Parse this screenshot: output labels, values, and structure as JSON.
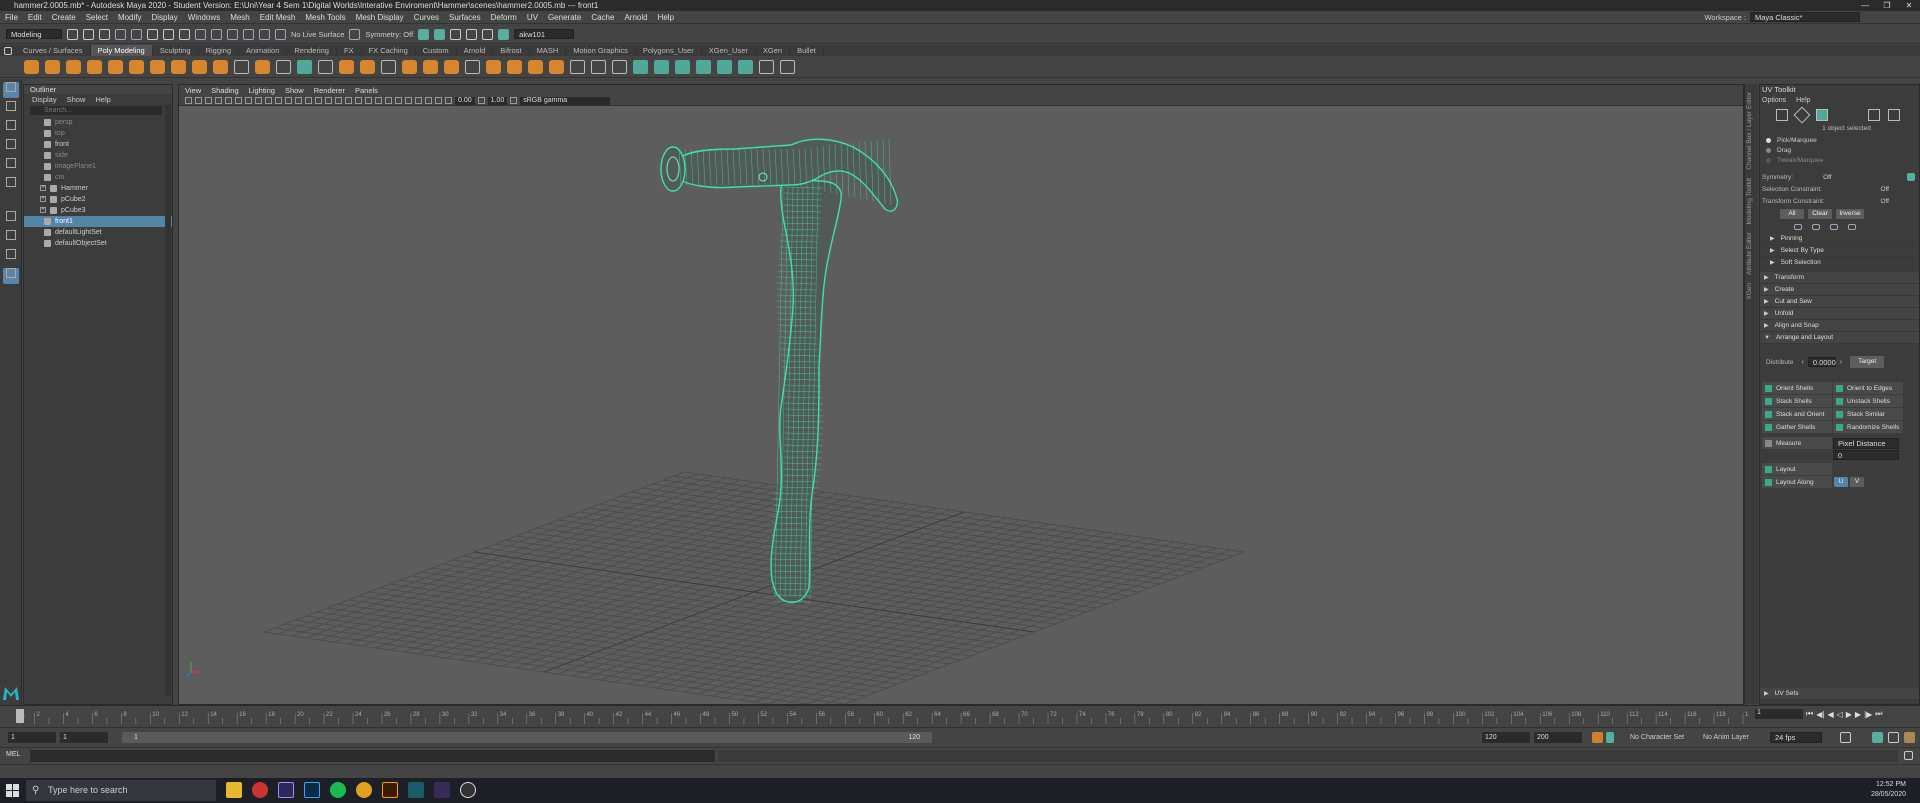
{
  "window": {
    "title": "hammer2.0005.mb* - Autodesk Maya 2020 - Student Version: E:\\Uni\\Year 4 Sem 1\\Digital Worlds\\Interative Enviroment\\Hammer\\scenes\\hammer2.0005.mb  ---  front1"
  },
  "menubar": {
    "items": [
      "File",
      "Edit",
      "Create",
      "Select",
      "Modify",
      "Display",
      "Windows",
      "Mesh",
      "Edit Mesh",
      "Mesh Tools",
      "Mesh Display",
      "Curves",
      "Surfaces",
      "Deform",
      "UV",
      "Generate",
      "Cache",
      "Arnold",
      "Help"
    ],
    "workspace_label": "Workspace :",
    "workspace_value": "Maya Classic*"
  },
  "statusline": {
    "menuset": "Modeling",
    "live_surface": "No Live Surface",
    "symmetry": "Symmetry: Off",
    "user": "akw101"
  },
  "shelf": {
    "tabs": [
      "Curves / Surfaces",
      "Poly Modeling",
      "Sculpting",
      "Rigging",
      "Animation",
      "Rendering",
      "FX",
      "FX Caching",
      "Custom",
      "Arnold",
      "Bifrost",
      "MASH",
      "Motion Graphics",
      "Polygons_User",
      "XGen_User",
      "XGen",
      "Bullet"
    ],
    "active_tab": "Poly Modeling"
  },
  "outliner": {
    "title": "Outliner",
    "menu": [
      "Display",
      "Show",
      "Help"
    ],
    "search_placeholder": "Search...",
    "items": [
      {
        "label": "persp",
        "dim": true,
        "expand": false
      },
      {
        "label": "top",
        "dim": true,
        "expand": false
      },
      {
        "label": "front",
        "dim": false,
        "expand": false
      },
      {
        "label": "side",
        "dim": true,
        "expand": false
      },
      {
        "label": "imagePlane1",
        "dim": true,
        "expand": false
      },
      {
        "label": "cm",
        "dim": true,
        "expand": false
      },
      {
        "label": "Hammer",
        "dim": false,
        "expand": true
      },
      {
        "label": "pCube2",
        "dim": false,
        "expand": true
      },
      {
        "label": "pCube3",
        "dim": false,
        "expand": true
      },
      {
        "label": "front1",
        "dim": false,
        "expand": false,
        "selected": true
      },
      {
        "label": "defaultLightSet",
        "dim": false,
        "expand": false
      },
      {
        "label": "defaultObjectSet",
        "dim": false,
        "expand": false
      }
    ]
  },
  "viewport": {
    "menu": [
      "View",
      "Shading",
      "Lighting",
      "Show",
      "Renderer",
      "Panels"
    ],
    "field_a": "0.00",
    "field_b": "1.00",
    "colorspace": "sRGB gamma"
  },
  "sidetabs": [
    "Channel Box / Layer Editor",
    "Modeling Toolkit",
    "Attribute Editor",
    "XGen"
  ],
  "uvtoolkit": {
    "title": "UV Toolkit",
    "menu": [
      "Options",
      "Help"
    ],
    "selected_text": "1 object selected",
    "modes": [
      {
        "label": "Pick/Marquee",
        "dim": false
      },
      {
        "label": "Drag",
        "dim": false
      },
      {
        "label": "Tweak/Marquee",
        "dim": true
      }
    ],
    "symmetry_label": "Symmetry:",
    "symmetry_value": "Off",
    "selection_constraint_label": "Selection Constraint:",
    "selection_constraint_value": "Off",
    "transform_constraint_label": "Transform Constraint:",
    "transform_constraint_value": "Off",
    "buttons": [
      "All",
      "Clear",
      "Inverse"
    ],
    "subsections": [
      "Pinning",
      "Select By Type",
      "Soft Selection"
    ],
    "sections": [
      "Transform",
      "Create",
      "Cut and Sew",
      "Unfold",
      "Align and Snap",
      "Arrange and Layout"
    ],
    "distribute_label": "Distribute",
    "distribute_value": "0.0000",
    "target_label": "Target",
    "grid_buttons": [
      "Orient Shells",
      "Orient to Edges",
      "Stack Shells",
      "Unstack Shells",
      "Stack and Orient",
      "Stack Similar",
      "Gather Shells",
      "Randomize Shells"
    ],
    "measure_label": "Measure",
    "measure_value": "Pixel Distance",
    "measure_number": "0",
    "layout_label": "Layout",
    "layout_along_label": "Layout Along",
    "layout_u": "U",
    "layout_v": "V",
    "uvsets_label": "UV Sets"
  },
  "timeslider": {
    "ticks": [
      "1",
      "2",
      "4",
      "6",
      "8",
      "10",
      "12",
      "14",
      "16",
      "18",
      "20",
      "22",
      "24",
      "26",
      "28",
      "30",
      "32",
      "34",
      "36",
      "38",
      "40",
      "42",
      "44",
      "46",
      "48",
      "50",
      "52",
      "54",
      "56",
      "58",
      "60",
      "62",
      "64",
      "66",
      "68",
      "70",
      "72",
      "74",
      "76",
      "78",
      "80",
      "82",
      "84",
      "86",
      "88",
      "90",
      "92",
      "94",
      "96",
      "98",
      "100",
      "102",
      "104",
      "106",
      "108",
      "110",
      "112",
      "114",
      "116",
      "118",
      "120"
    ],
    "current_frame": "1"
  },
  "range": {
    "start": "1",
    "start2": "1",
    "bar_start": "1",
    "bar_end": "120",
    "end": "120",
    "end2": "200",
    "character_set": "No Character Set",
    "anim_layer": "No Anim Layer",
    "fps": "24 fps"
  },
  "cmdline": {
    "label": "MEL"
  },
  "taskbar": {
    "search_placeholder": "Type here to search",
    "time": "12:52 PM",
    "date": "28/05/2020"
  }
}
